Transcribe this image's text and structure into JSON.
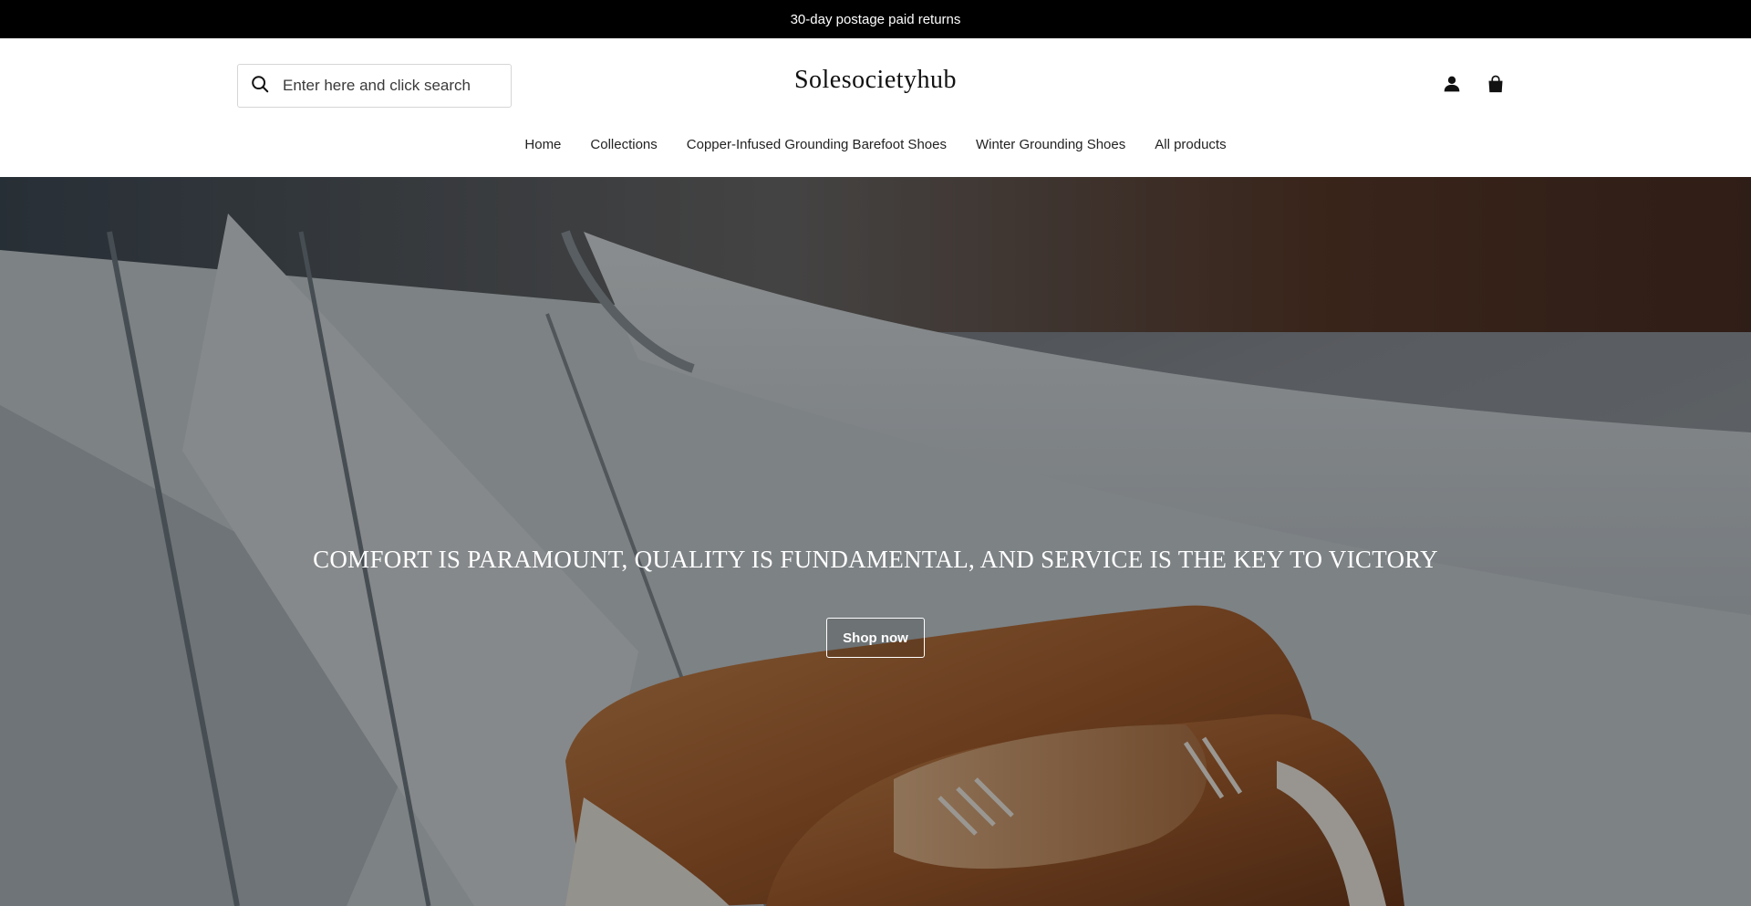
{
  "announcement": {
    "text": "30-day postage paid returns"
  },
  "header": {
    "search": {
      "placeholder": "Enter here and click search",
      "icon": "search-icon"
    },
    "logo": "Solesocietyhub",
    "icons": {
      "account": "user-icon",
      "cart": "shopping-bag-icon"
    }
  },
  "nav": {
    "items": [
      {
        "label": "Home"
      },
      {
        "label": "Collections"
      },
      {
        "label": "Copper-Infused Grounding Barefoot Shoes"
      },
      {
        "label": "Winter Grounding Shoes"
      },
      {
        "label": "All products"
      }
    ]
  },
  "hero": {
    "heading": "COMFORT IS PARAMOUNT, QUALITY IS FUNDAMENTAL, AND SERVICE IS THE KEY TO VICTORY",
    "button_label": "Shop now",
    "image": "hero-image-boat-shoes"
  },
  "colors": {
    "announcement_bg": "#000000",
    "text": "#111111",
    "hero_overlay": "rgba(0,0,0,0.36)"
  }
}
